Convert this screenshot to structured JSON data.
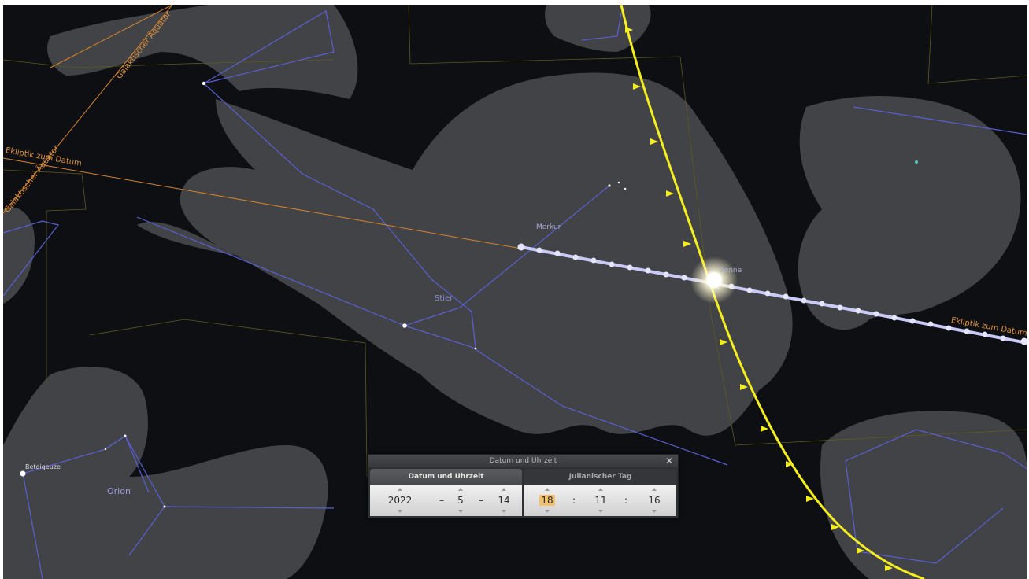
{
  "sky": {
    "labels": {
      "ecliptic_left": "Ekliptik zum Datum",
      "galactic_equator_1": "Galaktischer Äquator",
      "galactic_equator_2": "Galaktischer Äquator",
      "mercury": "Merkur",
      "sun": "Sonne",
      "taurus": "Stier",
      "ecliptic_right": "Ekliptik zum Datum",
      "betelgeuse": "Beteigeuze",
      "orion": "Orion"
    },
    "colors": {
      "constellation_lines": "#5a5fd0",
      "ecliptic_orange": "#d7832c",
      "ecliptic_track": "#c9cbf6",
      "horizon_yellow": "#f4ee1e"
    }
  },
  "dialog": {
    "title": "Datum und Uhrzeit",
    "close_icon": "close-icon",
    "tabs": [
      {
        "label": "Datum und Uhrzeit",
        "active": true
      },
      {
        "label": "Julianischer Tag",
        "active": false
      }
    ],
    "date": {
      "year": "2022",
      "month": "5",
      "day": "14",
      "separator": "–"
    },
    "time": {
      "hour": "18",
      "minute": "11",
      "second": "16",
      "separator": ":"
    }
  }
}
